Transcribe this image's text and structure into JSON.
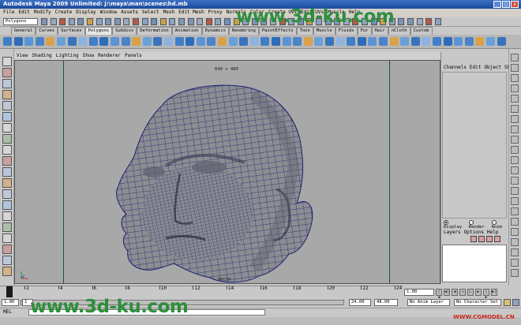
{
  "window": {
    "title": "Autodesk Maya 2009 Unlimited: j:\\maya\\man\\scenes\\hd.mb",
    "controls": [
      "_",
      "□",
      "x"
    ]
  },
  "menubar": {
    "items": [
      "File",
      "Edit",
      "Modify",
      "Create",
      "Display",
      "Window",
      "Assets",
      "Select",
      "Mesh",
      "Edit Mesh",
      "Proxy",
      "Normals",
      "Color",
      "Create UVs",
      "Edit UVs",
      "Muscle",
      "Help"
    ]
  },
  "status_line": {
    "mode": "Polygons"
  },
  "shelf": {
    "tabs": [
      "General",
      "Curves",
      "Surfaces",
      "Polygons",
      "Subdivs",
      "Deformation",
      "Animation",
      "Dynamics",
      "Rendering",
      "PaintEffects",
      "Toon",
      "Muscle",
      "Fluids",
      "Fur",
      "Hair",
      "nCloth",
      "Custom"
    ],
    "active_tab": "Polygons"
  },
  "viewport": {
    "menu": [
      "View",
      "Shading",
      "Lighting",
      "Show",
      "Renderer",
      "Panels"
    ],
    "resolution_label": "640 x 480",
    "camera_label": "persp"
  },
  "channel_box": {
    "menu": [
      "Channels",
      "Edit",
      "Object",
      "Show"
    ]
  },
  "layer_editor": {
    "modes": [
      "Display",
      "Render",
      "Anim"
    ],
    "selected_mode": "Display",
    "menu": [
      "Layers",
      "Options",
      "Help"
    ]
  },
  "time_slider": {
    "ticks": [
      "1",
      "2",
      "4",
      "6",
      "8",
      "10",
      "12",
      "14",
      "16",
      "18",
      "20",
      "22",
      "24"
    ],
    "current_frame": "1.00"
  },
  "range_slider": {
    "start": "1.00",
    "start_inner": "1",
    "end_inner": "24.00",
    "end": "48.00",
    "anim_layer": "No Anim Layer",
    "character_set": "No Character Set"
  },
  "command_line": {
    "label": "MEL"
  },
  "watermarks": {
    "top": "www.3d-ku.com",
    "bottom": "www.3d-ku.com",
    "corner": "WWW.CGMODEL.CN"
  },
  "colors": {
    "titlebar": "#1c4a9a",
    "viewport_bg": "#a8a8a8",
    "mesh_wire": "#1a1f6e",
    "mesh_fill": "#8c8d92",
    "gate_line": "#1e5a2a",
    "watermark": "#2f8f3f"
  }
}
